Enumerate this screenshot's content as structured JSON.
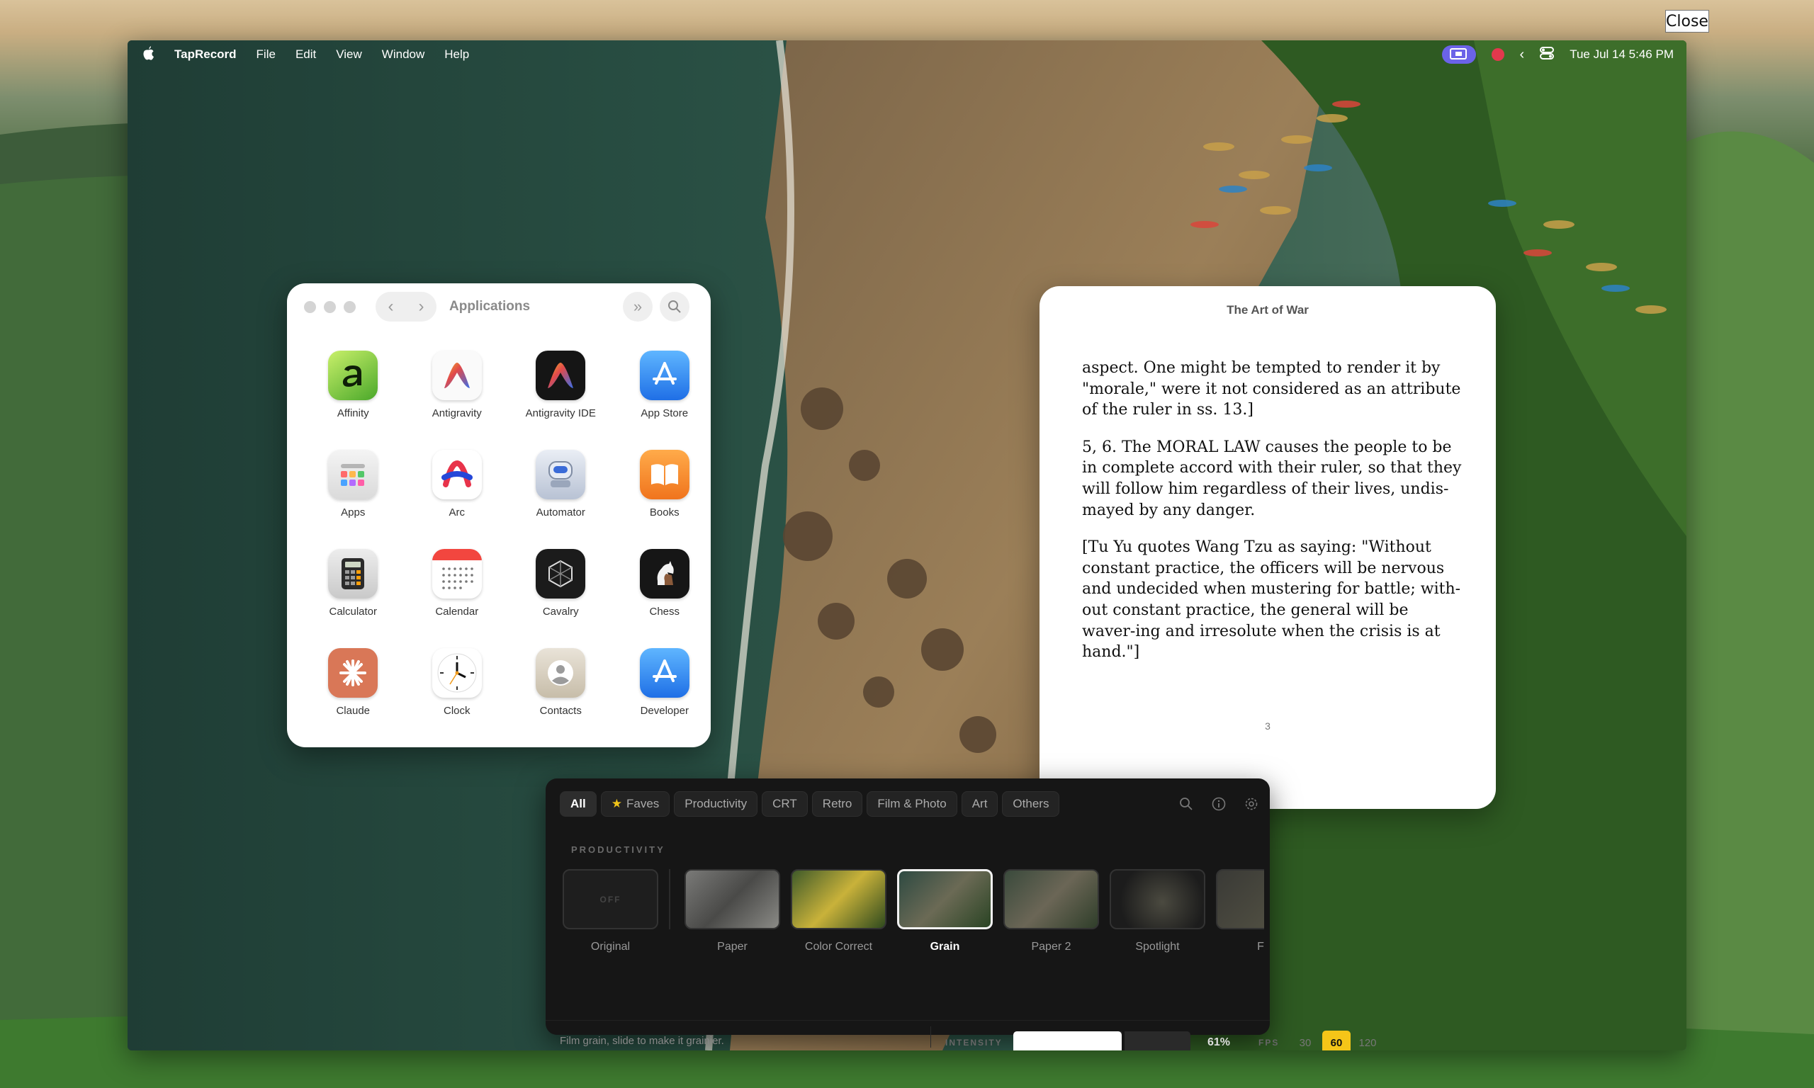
{
  "overlay": {
    "close_label": "Close"
  },
  "menubar": {
    "app_name": "TapRecord",
    "menus": [
      "File",
      "Edit",
      "View",
      "Window",
      "Help"
    ],
    "clock": "Tue Jul 14  5:46 PM"
  },
  "finder": {
    "title": "Applications",
    "apps": [
      {
        "name": "Affinity",
        "icon": "affinity-icon"
      },
      {
        "name": "Antigravity",
        "icon": "antigravity-icon"
      },
      {
        "name": "Antigravity IDE",
        "icon": "antigravity-ide-icon"
      },
      {
        "name": "App Store",
        "icon": "app-store-icon"
      },
      {
        "name": "Apps",
        "icon": "apps-icon"
      },
      {
        "name": "Arc",
        "icon": "arc-icon"
      },
      {
        "name": "Automator",
        "icon": "automator-icon"
      },
      {
        "name": "Books",
        "icon": "books-icon"
      },
      {
        "name": "Calculator",
        "icon": "calculator-icon"
      },
      {
        "name": "Calendar",
        "icon": "calendar-icon"
      },
      {
        "name": "Cavalry",
        "icon": "cavalry-icon"
      },
      {
        "name": "Chess",
        "icon": "chess-icon"
      },
      {
        "name": "Claude",
        "icon": "claude-icon"
      },
      {
        "name": "Clock",
        "icon": "clock-icon"
      },
      {
        "name": "Contacts",
        "icon": "contacts-icon"
      },
      {
        "name": "Developer",
        "icon": "developer-icon"
      }
    ]
  },
  "book": {
    "title": "The Art of War",
    "paragraphs": [
      "aspect. One might be tempted to render it by \"morale,\" were it not considered as an attribute of the ruler in ss. 13.]",
      "5, 6. The MORAL LAW causes the people to be in complete accord with their ruler, so that they will follow him regardless of their lives, undis-mayed by any danger.",
      "[Tu Yu quotes Wang Tzu as saying: \"Without constant practice, the officers will be nervous and undecided when mustering for battle; with-out constant practice, the general will be waver-ing and irresolute when the crisis is at hand.\"]"
    ],
    "page_number": "3"
  },
  "effects": {
    "tabs": [
      "All",
      "Faves",
      "Productivity",
      "CRT",
      "Retro",
      "Film & Photo",
      "Art",
      "Others"
    ],
    "active_tab": "All",
    "section_title": "PRODUCTIVITY",
    "off_text": "OFF",
    "presets": [
      "Original",
      "Paper",
      "Color Correct",
      "Grain",
      "Paper 2",
      "Spotlight",
      "Fo"
    ],
    "selected_preset": "Grain",
    "hint": "Film grain, slide to make it grainier.",
    "intensity_label": "INTENSITY",
    "intensity_value": "61%",
    "intensity_fraction": 0.61,
    "fps_label": "FPS",
    "fps_options": [
      "30",
      "60",
      "120"
    ],
    "fps_selected": "60"
  },
  "colors": {
    "accent_fps": "#f5c518",
    "record_pill": "#6b63e8",
    "record_dot": "#e2394d"
  }
}
